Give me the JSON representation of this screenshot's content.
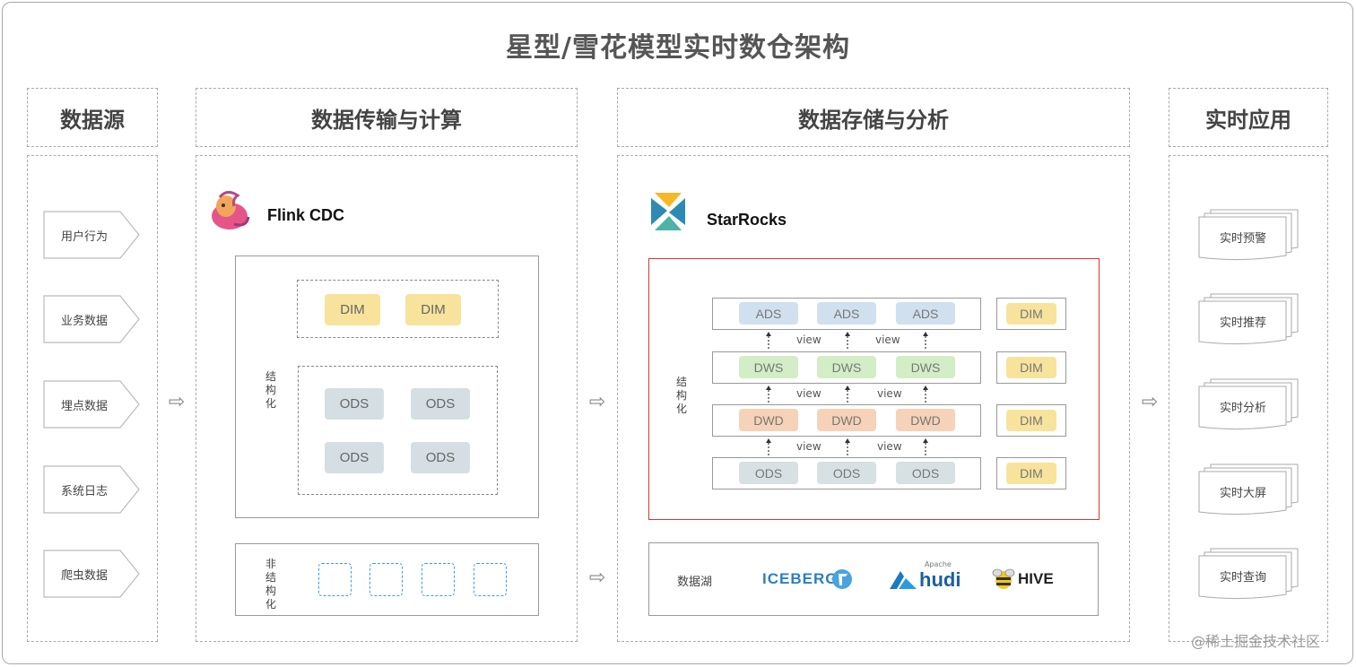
{
  "title": "星型/雪花模型实时数仓架构",
  "columns": {
    "source": "数据源",
    "compute": "数据传输与计算",
    "storage": "数据存储与分析",
    "apps": "实时应用"
  },
  "sources": [
    "用户行为",
    "业务数据",
    "埋点数据",
    "系统日志",
    "爬虫数据"
  ],
  "compute": {
    "brand": "Flink CDC",
    "structured_label": "结构化",
    "unstructured_label": "非结构化",
    "dim_chips": [
      "DIM",
      "DIM"
    ],
    "ods_chips": [
      "ODS",
      "ODS",
      "ODS",
      "ODS"
    ]
  },
  "storage": {
    "brand": "StarRocks",
    "structured_label": "结构化",
    "view_label": "view",
    "layers": [
      {
        "name": "ADS",
        "cells": [
          "ADS",
          "ADS",
          "ADS"
        ],
        "dim": "DIM"
      },
      {
        "name": "DWS",
        "cells": [
          "DWS",
          "DWS",
          "DWS"
        ],
        "dim": "DIM"
      },
      {
        "name": "DWD",
        "cells": [
          "DWD",
          "DWD",
          "DWD"
        ],
        "dim": "DIM"
      },
      {
        "name": "ODS",
        "cells": [
          "ODS",
          "ODS",
          "ODS"
        ],
        "dim": "DIM"
      }
    ],
    "lake_label": "数据湖",
    "lake_logos": [
      "ICEBERG",
      "hudi",
      "HIVE"
    ],
    "hudi_small": "Apache"
  },
  "apps": [
    "实时预警",
    "实时推荐",
    "实时分析",
    "实时大屏",
    "实时查询"
  ],
  "arrow_glyph": "⇨",
  "watermark": "@稀土掘金技术社区",
  "colors": {
    "dim": "#f8e39c",
    "ods": "#d5dfe3",
    "ads": "#d0e0ef",
    "dws": "#d3edc7",
    "dwd": "#f5d2b8",
    "highlight_border": "#d9362f",
    "unstructured_dash": "#3b9ee6"
  }
}
